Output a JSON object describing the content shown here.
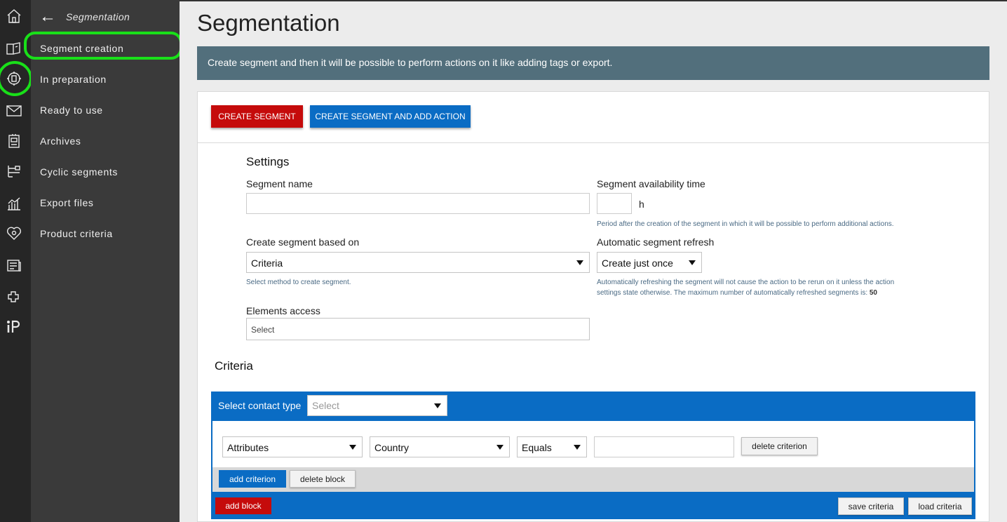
{
  "sidebar": {
    "title": "Segmentation",
    "items": [
      {
        "label": "Segment creation"
      },
      {
        "label": "In preparation"
      },
      {
        "label": "Ready to use"
      },
      {
        "label": "Archives"
      },
      {
        "label": "Cyclic segments"
      },
      {
        "label": "Export files"
      },
      {
        "label": "Product criteria"
      }
    ]
  },
  "rail": {
    "icons": [
      "home-icon",
      "documents-icon",
      "segmentation-icon",
      "mail-icon",
      "automation-icon",
      "scenario-icon",
      "analytics-icon",
      "loyalty-icon",
      "news-icon",
      "integrations-icon",
      "ip-icon"
    ]
  },
  "page": {
    "title": "Segmentation",
    "banner": "Create segment and then it will be possible to perform actions on it like adding tags or export."
  },
  "actions": {
    "create": "CREATE SEGMENT",
    "create_action": "CREATE SEGMENT AND ADD ACTION"
  },
  "settings": {
    "heading": "Settings",
    "name_label": "Segment name",
    "name_value": "",
    "availability_label": "Segment availability time",
    "availability_value": "",
    "availability_unit": "h",
    "availability_help": "Period after the creation of the segment in which it will be possible to perform additional actions.",
    "based_on_label": "Create segment based on",
    "based_on_value": "Criteria",
    "based_on_help": "Select method to create segment.",
    "refresh_label": "Automatic segment refresh",
    "refresh_value": "Create just once",
    "refresh_help_1": "Automatically refreshing the segment will not cause the action to be rerun on it unless the action",
    "refresh_help_2": "settings state otherwise. The maximum number of automatically refreshed segments is:",
    "refresh_max": "50",
    "access_label": "Elements access",
    "access_placeholder": "Select"
  },
  "criteria": {
    "heading": "Criteria",
    "contact_type_label": "Select contact type",
    "contact_type_placeholder": "Select",
    "row": {
      "source": "Attributes",
      "field": "Country",
      "operator": "Equals",
      "value": "",
      "delete": "delete criterion"
    },
    "add_criterion": "add criterion",
    "delete_block": "delete block",
    "add_block": "add block",
    "save": "save criteria",
    "load": "load criteria"
  }
}
